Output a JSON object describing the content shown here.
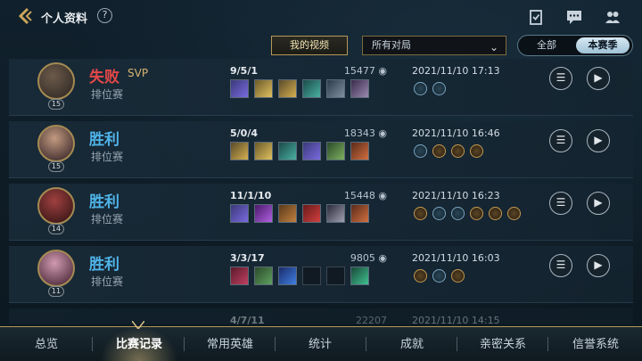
{
  "header": {
    "title": "个人资料",
    "help_label": "?"
  },
  "filters": {
    "my_video_label": "我的视频",
    "match_filter_value": "所有对局",
    "scope_all_label": "全部",
    "scope_season_label": "本赛季"
  },
  "matches": [
    {
      "result": "失败",
      "result_type": "loss",
      "svp": "SVP",
      "mode": "排位赛",
      "level": "15",
      "kda": "9/5/1",
      "gold": "15477",
      "time": "2021/11/10 17:13",
      "items": 6,
      "empty_items": 0,
      "badges": [
        "blue",
        "blue"
      ]
    },
    {
      "result": "胜利",
      "result_type": "win",
      "svp": "",
      "mode": "排位赛",
      "level": "15",
      "kda": "5/0/4",
      "gold": "18343",
      "time": "2021/11/10 16:46",
      "items": 6,
      "empty_items": 0,
      "badges": [
        "blue",
        "gold",
        "gold",
        "gold"
      ]
    },
    {
      "result": "胜利",
      "result_type": "win",
      "svp": "",
      "mode": "排位赛",
      "level": "14",
      "kda": "11/1/10",
      "gold": "15448",
      "time": "2021/11/10 16:23",
      "items": 6,
      "empty_items": 0,
      "badges": [
        "gold",
        "blue",
        "blue",
        "gold",
        "gold",
        "gold"
      ]
    },
    {
      "result": "胜利",
      "result_type": "win",
      "svp": "",
      "mode": "排位赛",
      "level": "11",
      "kda": "3/3/17",
      "gold": "9805",
      "time": "2021/11/10 16:03",
      "items": 3,
      "empty_items": 2,
      "badges": [
        "gold",
        "blue",
        "gold"
      ]
    }
  ],
  "partial_row": {
    "kda": "4/7/11",
    "gold": "22207",
    "time": "2021/11/10 14:15"
  },
  "bottom_nav": {
    "items": [
      "总览",
      "比赛记录",
      "常用英雄",
      "统计",
      "成就",
      "亲密关系",
      "信誉系统"
    ],
    "active_index": 1
  },
  "colors": {
    "accent_gold": "#b59a5a",
    "win_blue": "#4fb3e8",
    "loss_red": "#e24848",
    "svp_gold": "#d8b570"
  }
}
